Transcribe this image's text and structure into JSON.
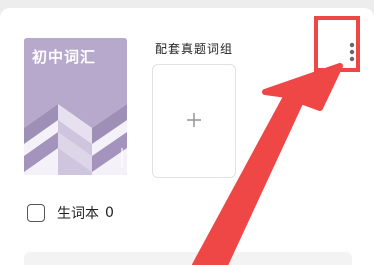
{
  "book": {
    "title": "初中词汇",
    "cover_color": "#b7a9cc",
    "spine_text": "初中词汇"
  },
  "practice_set": {
    "label": "配套真题词组",
    "add_icon": "plus-icon"
  },
  "menu": {
    "icon": "vertical-ellipsis-icon"
  },
  "vocab_book": {
    "label": "生词本",
    "count": "0",
    "checked": false
  },
  "annotation": {
    "color": "#ef4646",
    "highlight_target": "more-options-button",
    "arrow": "pointer-arrow"
  }
}
